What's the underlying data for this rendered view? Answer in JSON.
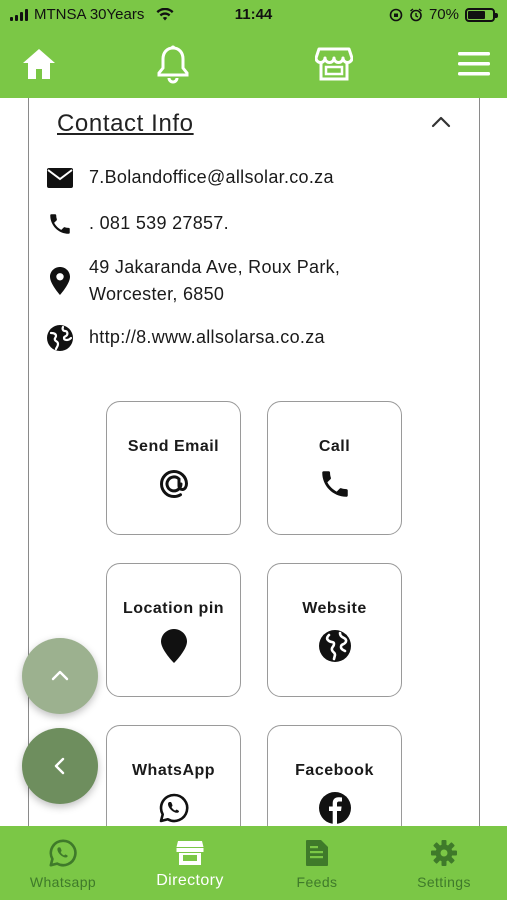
{
  "status_bar": {
    "carrier": "MTNSA 30Years",
    "time": "11:44",
    "battery_percent": "70%",
    "battery_level": 0.7
  },
  "top_nav": {
    "icons": [
      "home-icon",
      "bell-icon",
      "store-icon",
      "menu-icon"
    ]
  },
  "contact": {
    "title": "Contact Info",
    "email": "7.Bolandoffice@allsolar.co.za",
    "phone": ". 081 539 27857.",
    "address_line1": "49 Jakaranda Ave, Roux Park,",
    "address_line2": "Worcester, 6850",
    "website": "http://8.www.allsolarsa.co.za"
  },
  "actions": {
    "send_email": "Send Email",
    "call": "Call",
    "location_pin": "Location pin",
    "website": "Website",
    "whatsapp": "WhatsApp",
    "facebook": "Facebook"
  },
  "bottom_nav": {
    "whatsapp": "Whatsapp",
    "directory": "Directory",
    "feeds": "Feeds",
    "settings": "Settings",
    "active": "Directory"
  },
  "colors": {
    "brand_green": "#7bc746",
    "tab_inactive": "#3f7a2a",
    "fab_up": "#9cb18f",
    "fab_back": "#6e8e5e"
  }
}
